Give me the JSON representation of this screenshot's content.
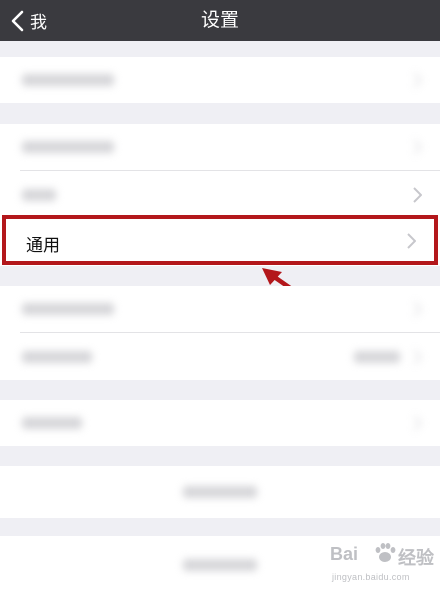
{
  "nav": {
    "back_label": "我",
    "title": "设置"
  },
  "highlighted_item": {
    "label": "通用"
  },
  "watermark": {
    "brand": "Bai",
    "brand_suffix": "经验",
    "url": "jingyan.baidu.com"
  },
  "colors": {
    "navbar": "#3a3a3f",
    "highlight_border": "#b3171b",
    "arrow": "#b3171b",
    "background": "#efeff4"
  }
}
